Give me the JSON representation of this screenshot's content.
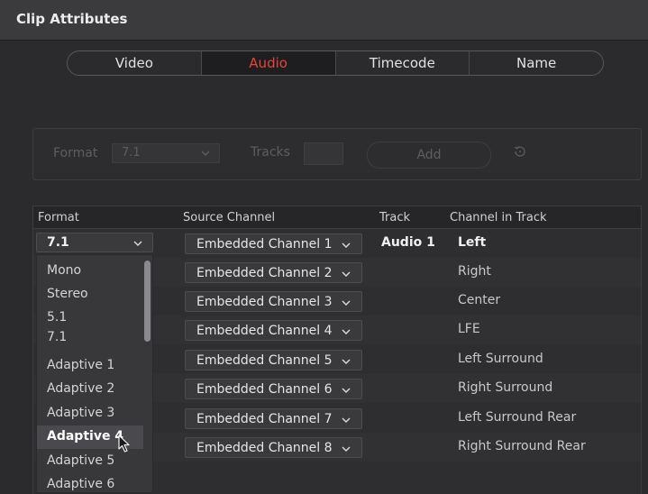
{
  "window": {
    "title": "Clip Attributes"
  },
  "tabs": [
    {
      "label": "Video",
      "active": false
    },
    {
      "label": "Audio",
      "active": true
    },
    {
      "label": "Timecode",
      "active": false
    },
    {
      "label": "Name",
      "active": false
    }
  ],
  "format_bar": {
    "format_label": "Format",
    "format_value": "7.1",
    "tracks_label": "Tracks",
    "tracks_value": "",
    "add_label": "Add",
    "reset_icon": "reset-icon"
  },
  "table": {
    "headers": {
      "format": "Format",
      "source_channel": "Source Channel",
      "track": "Track",
      "channel_in_track": "Channel in Track"
    },
    "format_value": "7.1",
    "rows": [
      {
        "source": "Embedded Channel 1",
        "track": "Audio 1",
        "channel": "Left"
      },
      {
        "source": "Embedded Channel 2",
        "track": "",
        "channel": "Right"
      },
      {
        "source": "Embedded Channel 3",
        "track": "",
        "channel": "Center"
      },
      {
        "source": "Embedded Channel 4",
        "track": "",
        "channel": "LFE"
      },
      {
        "source": "Embedded Channel 5",
        "track": "",
        "channel": "Left Surround"
      },
      {
        "source": "Embedded Channel 6",
        "track": "",
        "channel": "Right Surround"
      },
      {
        "source": "Embedded Channel 7",
        "track": "",
        "channel": "Left Surround Rear"
      },
      {
        "source": "Embedded Channel 8",
        "track": "",
        "channel": "Right Surround Rear"
      }
    ]
  },
  "format_dropdown": {
    "options": [
      "Mono",
      "Stereo",
      "5.1",
      "7.1",
      "Adaptive 1",
      "Adaptive 2",
      "Adaptive 3",
      "Adaptive 4",
      "Adaptive 5",
      "Adaptive 6"
    ],
    "hovered": "Adaptive 4"
  },
  "colors": {
    "accent_active_tab": "#e5453b",
    "background": "#2b2b2d",
    "dropdown_bg": "#38383b"
  }
}
